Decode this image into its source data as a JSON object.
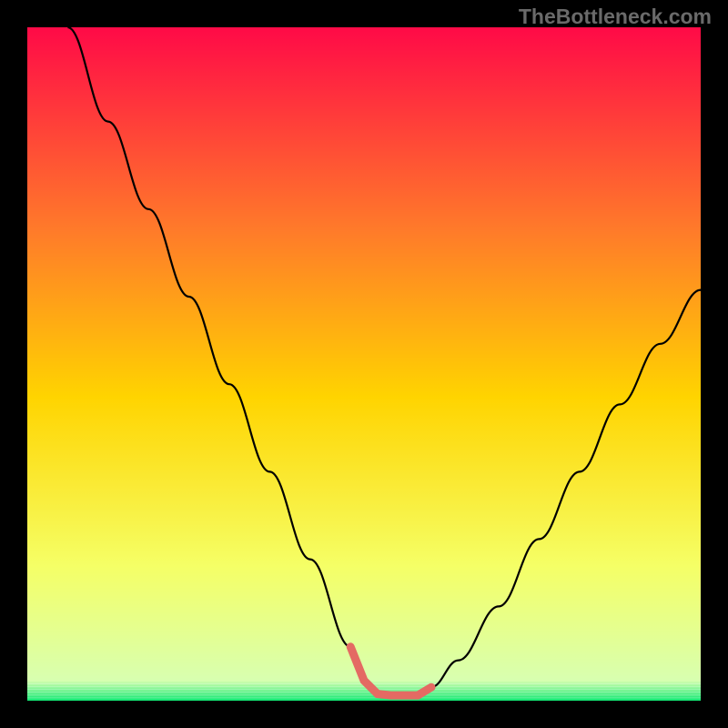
{
  "watermark": "TheBottleneck.com",
  "chart_data": {
    "type": "line",
    "title": "",
    "xlabel": "",
    "ylabel": "",
    "xlim": [
      0,
      100
    ],
    "ylim": [
      0,
      100
    ],
    "series": [
      {
        "name": "curve",
        "x": [
          6,
          12,
          18,
          24,
          30,
          36,
          42,
          48,
          50,
          52,
          54,
          56,
          58,
          60,
          64,
          70,
          76,
          82,
          88,
          94,
          100
        ],
        "y": [
          100,
          86,
          73,
          60,
          47,
          34,
          21,
          8,
          3,
          1,
          0.5,
          0.5,
          0.8,
          2,
          6,
          14,
          24,
          34,
          44,
          53,
          61
        ]
      }
    ],
    "green_band": {
      "y_from": 0,
      "y_to": 2.5
    },
    "red_marker": {
      "x_from": 48,
      "x_to": 60,
      "y": 0.8
    },
    "colors": {
      "gradient_top": "#ff0a47",
      "gradient_mid_upper": "#ff7a2a",
      "gradient_mid": "#ffd400",
      "gradient_mid_lower": "#f5ff66",
      "gradient_bottom": "#10e872",
      "curve": "#000000",
      "marker": "#e46a63",
      "frame": "#000000"
    }
  }
}
